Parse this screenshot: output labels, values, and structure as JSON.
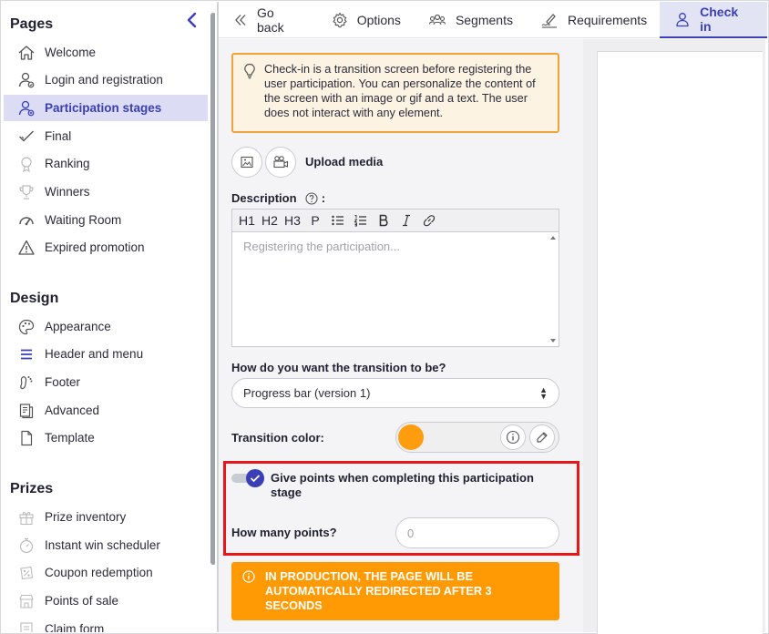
{
  "sidebar": {
    "sections": {
      "pages": "Pages",
      "design": "Design",
      "prizes": "Prizes"
    },
    "pages_items": [
      {
        "label": "Welcome",
        "icon": "home-icon"
      },
      {
        "label": "Login and registration",
        "icon": "user-login-icon"
      },
      {
        "label": "Participation stages",
        "icon": "user-stages-icon",
        "active": true
      },
      {
        "label": "Final",
        "icon": "checkmark-icon"
      },
      {
        "label": "Ranking",
        "icon": "medal-icon"
      },
      {
        "label": "Winners",
        "icon": "trophy-icon"
      },
      {
        "label": "Waiting Room",
        "icon": "gauge-icon"
      },
      {
        "label": "Expired promotion",
        "icon": "warning-icon"
      }
    ],
    "design_items": [
      {
        "label": "Appearance",
        "icon": "palette-icon"
      },
      {
        "label": "Header and menu",
        "icon": "menu-icon"
      },
      {
        "label": "Footer",
        "icon": "footprint-icon"
      },
      {
        "label": "Advanced",
        "icon": "advanced-icon"
      },
      {
        "label": "Template",
        "icon": "document-icon"
      }
    ],
    "prizes_items": [
      {
        "label": "Prize inventory",
        "icon": "gift-icon"
      },
      {
        "label": "Instant win scheduler",
        "icon": "stopwatch-icon"
      },
      {
        "label": "Coupon redemption",
        "icon": "coupon-icon"
      },
      {
        "label": "Points of sale",
        "icon": "store-icon"
      },
      {
        "label": "Claim form",
        "icon": "form-icon"
      }
    ]
  },
  "tabs": [
    {
      "label": "Go back",
      "icon": "double-chevron-left-icon"
    },
    {
      "label": "Options",
      "icon": "gear-icon"
    },
    {
      "label": "Segments",
      "icon": "users-group-icon"
    },
    {
      "label": "Requirements",
      "icon": "signature-icon"
    },
    {
      "label": "Check in",
      "icon": "user-location-icon",
      "active": true
    }
  ],
  "form": {
    "info_text": "Check-in is a transition screen before registering the user participation. You can personalize the content of the screen with an image or gif and a text. The user does not interact with any element.",
    "upload_label": "Upload media",
    "description_label": "Description",
    "description_colon": ":",
    "toolbar": [
      "H1",
      "H2",
      "H3",
      "P"
    ],
    "editor_placeholder": "Registering the participation...",
    "transition_label": "How do you want the transition to be?",
    "transition_value": "Progress bar (version 1)",
    "color_label": "Transition color:",
    "color_value": "#ff9d0f",
    "give_points_label": "Give points when completing this participation stage",
    "give_points_enabled": true,
    "points_label": "How many points?",
    "points_placeholder": "0",
    "warning_text": "IN PRODUCTION, THE PAGE WILL BE AUTOMATICALLY REDIRECTED AFTER 3 SECONDS"
  },
  "colors": {
    "accent": "#3a3fb8",
    "warning": "#ff9a05",
    "highlight": "#e8161b"
  }
}
